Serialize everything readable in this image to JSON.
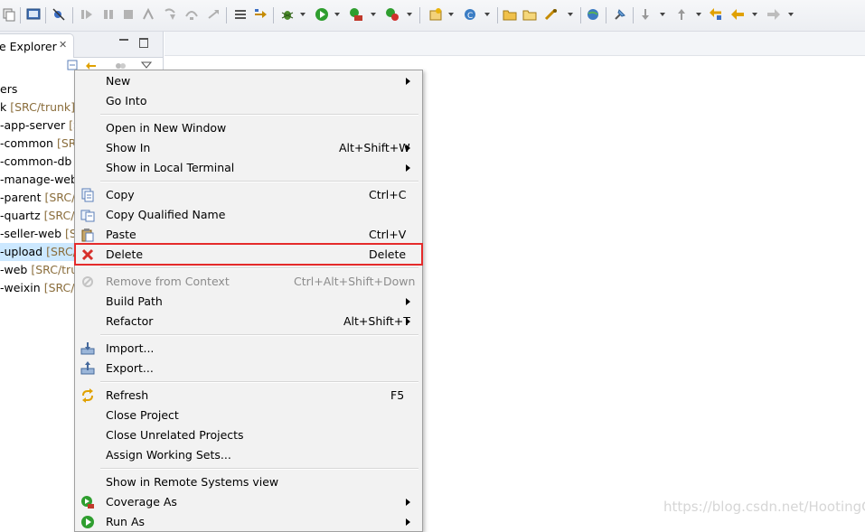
{
  "toolbar": {
    "icons": [
      "copy-icon",
      "console-icon",
      "skip-breakpoints-icon",
      "resume-icon",
      "suspend-icon",
      "terminate-icon",
      "disconnect-icon",
      "step-into-icon",
      "step-over-icon",
      "step-return-icon",
      "drop-frame-icon",
      "use-step-filters-icon",
      "debug-icon",
      "run-icon",
      "coverage-icon",
      "run-external-tool-icon",
      "new-project-icon",
      "new-class-icon",
      "open-folder-icon",
      "open-type-icon",
      "search-icon",
      "globe-icon",
      "pin-icon",
      "next-annotation-icon",
      "previous-annotation-icon",
      "last-edit-location-icon",
      "back-icon",
      "forward-icon"
    ]
  },
  "explorer": {
    "tab_label": "e Explorer",
    "close_glyph": "✕",
    "items": [
      {
        "name": "ers",
        "repo": ""
      },
      {
        "name": "k",
        "repo": "[SRC/trunk]"
      },
      {
        "name": "-app-server",
        "repo": "[S"
      },
      {
        "name": "-common",
        "repo": "[SR"
      },
      {
        "name": "-common-db",
        "repo": "["
      },
      {
        "name": "-manage-web",
        "repo": ""
      },
      {
        "name": "-parent",
        "repo": "[SRC/tr"
      },
      {
        "name": "-quartz",
        "repo": "[SRC/tr"
      },
      {
        "name": "-seller-web",
        "repo": "[S"
      },
      {
        "name": "-upload",
        "repo": "[SRC/"
      },
      {
        "name": "-web",
        "repo": "[SRC/trun"
      },
      {
        "name": "-weixin",
        "repo": "[SRC/tr"
      }
    ]
  },
  "menu": {
    "new": {
      "label": "New",
      "shortcut": ""
    },
    "go_into": {
      "label": "Go Into",
      "shortcut": ""
    },
    "open_new_window": {
      "label": "Open in New Window",
      "shortcut": ""
    },
    "show_in": {
      "label": "Show In",
      "shortcut": "Alt+Shift+W"
    },
    "show_local_terminal": {
      "label": "Show in Local Terminal",
      "shortcut": ""
    },
    "copy": {
      "label": "Copy",
      "shortcut": "Ctrl+C"
    },
    "copy_qualified": {
      "label": "Copy Qualified Name",
      "shortcut": ""
    },
    "paste": {
      "label": "Paste",
      "shortcut": "Ctrl+V"
    },
    "delete": {
      "label": "Delete",
      "shortcut": "Delete"
    },
    "remove_context": {
      "label": "Remove from Context",
      "shortcut": "Ctrl+Alt+Shift+Down"
    },
    "build_path": {
      "label": "Build Path",
      "shortcut": ""
    },
    "refactor": {
      "label": "Refactor",
      "shortcut": "Alt+Shift+T"
    },
    "import": {
      "label": "Import...",
      "shortcut": ""
    },
    "export": {
      "label": "Export...",
      "shortcut": ""
    },
    "refresh": {
      "label": "Refresh",
      "shortcut": "F5"
    },
    "close_project": {
      "label": "Close Project",
      "shortcut": ""
    },
    "close_unrelated": {
      "label": "Close Unrelated Projects",
      "shortcut": ""
    },
    "assign_working_sets": {
      "label": "Assign Working Sets...",
      "shortcut": ""
    },
    "show_remote": {
      "label": "Show in Remote Systems view",
      "shortcut": ""
    },
    "coverage_as": {
      "label": "Coverage As",
      "shortcut": ""
    },
    "run_as": {
      "label": "Run As",
      "shortcut": ""
    }
  },
  "watermark": "https://blog.csdn.net/HootingC",
  "colors": {
    "highlight_border": "#e52b2b",
    "selection": "#cce8ff",
    "repo_text": "#8a6d3b"
  }
}
